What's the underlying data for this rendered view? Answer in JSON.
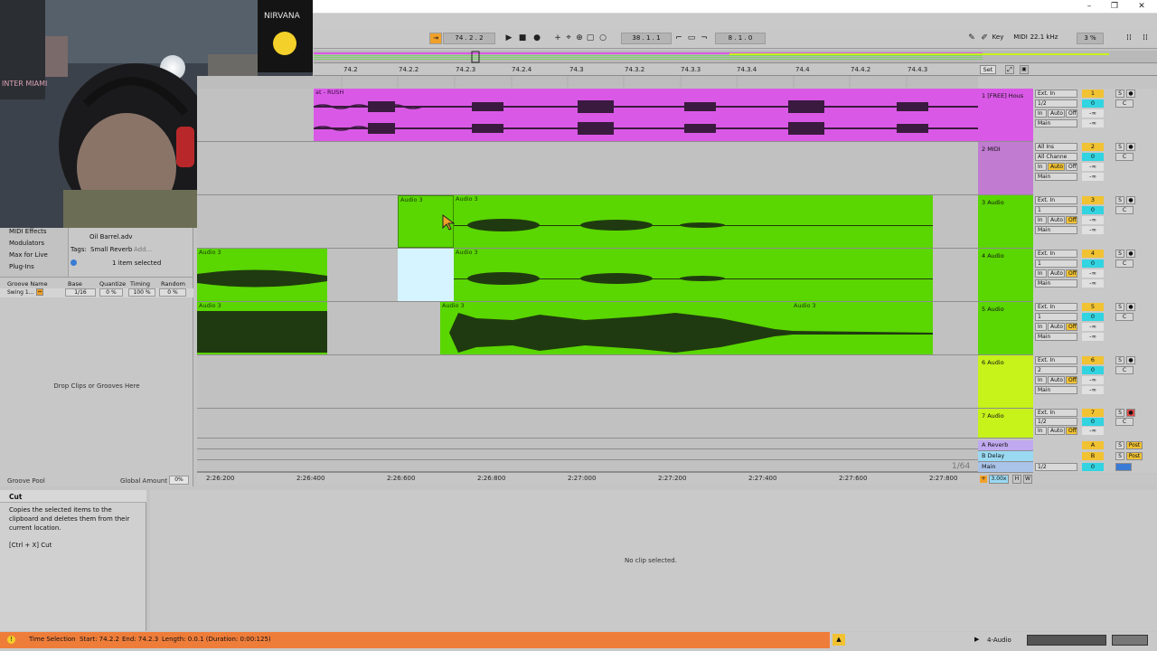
{
  "colors": {
    "magenta": "#d959e6",
    "green": "#5ad600",
    "lightgreen": "#7be84a",
    "yellow": "#c7f21a",
    "selection": "#d6f4ff",
    "orange": "#ef7d3a",
    "blue_return": "#9ad9f2"
  },
  "transport": {
    "position": "74 . 2 . 2",
    "loop_start": "38 . 1 . 1",
    "loop_length": "8 . 1 . 0",
    "key_label": "Key",
    "midi_label": "MIDI",
    "sample_rate": "22.1 kHz",
    "cpu": "3 %"
  },
  "ruler": {
    "labels": [
      "74.2",
      "74.2.2",
      "74.2.3",
      "74.2.4",
      "74.3",
      "74.3.2",
      "74.3.3",
      "74.3.4",
      "74.4",
      "74.4.2",
      "74.4.3"
    ],
    "set_button": "Set"
  },
  "browser": {
    "items": [
      "MIDI Effects",
      "Modulators",
      "Max for Live",
      "Plug-Ins"
    ],
    "file": "Oil Barrel.adv",
    "tags_label": "Tags:",
    "tag_value": "Small Reverb",
    "add_label": "Add...",
    "selection_text": "1 item selected"
  },
  "groove": {
    "columns": [
      "Groove Name",
      "Base",
      "Quantize",
      "Timing",
      "Random"
    ],
    "row": {
      "name": "Swing 1...",
      "base": "1/16",
      "quantize": "0 %",
      "timing": "100 %",
      "random": "0 %"
    },
    "drop_text": "Drop Clips or Grooves Here",
    "pool_label": "Groove Pool",
    "global_amount_label": "Global Amount",
    "global_amount_value": "0%"
  },
  "clips": {
    "track1": "at - RUSH",
    "audio3": "Audio 3"
  },
  "tracks": [
    {
      "name": "1 [FREE] Hous",
      "input": "Ext. In",
      "channel": "1/2",
      "num": "1",
      "pan": "C",
      "vol": "-∞"
    },
    {
      "name": "2 MIDI",
      "input": "All Ins",
      "channel": "All Channe",
      "num": "2",
      "pan": "C",
      "vol": "-∞"
    },
    {
      "name": "3 Audio",
      "input": "Ext. In",
      "channel": "1",
      "num": "3",
      "pan": "C",
      "vol": "-∞"
    },
    {
      "name": "4 Audio",
      "input": "Ext. In",
      "channel": "1",
      "num": "4",
      "pan": "C",
      "vol": "-∞"
    },
    {
      "name": "5 Audio",
      "input": "Ext. In",
      "channel": "1",
      "num": "5",
      "pan": "C",
      "vol": "-∞"
    },
    {
      "name": "6 Audio",
      "input": "Ext. In",
      "channel": "2",
      "num": "6",
      "pan": "C",
      "vol": "-∞"
    },
    {
      "name": "7 Audio",
      "input": "Ext. In",
      "channel": "1/2",
      "num": "7",
      "pan": "C",
      "vol": "-∞"
    }
  ],
  "monitor": {
    "in": "In",
    "auto": "Auto",
    "off": "Off",
    "main": "Main"
  },
  "returns": [
    {
      "name": "A Reverb",
      "num": "A",
      "post": "Post"
    },
    {
      "name": "B Delay",
      "num": "B",
      "post": "Post"
    }
  ],
  "main_track": {
    "name": "Main",
    "channel": "1/2",
    "num": "0"
  },
  "zoom_label": "1/64",
  "tempo_sub": "3.00x",
  "time_ruler": [
    "2:26:200",
    "2:26:400",
    "2:26:600",
    "2:26:800",
    "2:27:000",
    "2:27:200",
    "2:27:400",
    "2:27:600",
    "2:27:800"
  ],
  "info": {
    "title": "Cut",
    "body": "Copies the selected items to the clipboard and deletes them from their current location.",
    "shortcut": "[Ctrl + X] Cut"
  },
  "detail": {
    "empty_text": "No clip selected."
  },
  "status": {
    "label": "Time Selection",
    "start": "Start: 74.2.2",
    "end": "End: 74.2.3",
    "length": "Length: 0.0.1 (Duration: 0:00:125)",
    "track": "4-Audio"
  },
  "webcam": {
    "banner_text": "INTER MIAMI",
    "poster_text": "NIRVANA"
  }
}
